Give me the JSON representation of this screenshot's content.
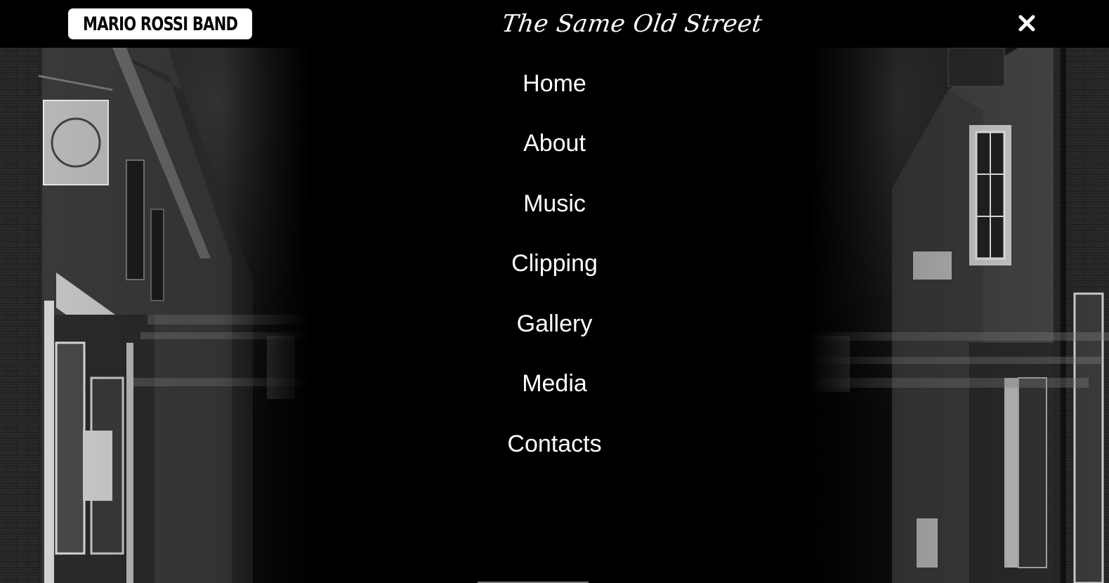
{
  "header": {
    "logo_text": "Mario Rossi Band",
    "site_title": "The Same Old Street",
    "close_icon": "close-icon"
  },
  "menu": {
    "items": [
      {
        "label": "Home"
      },
      {
        "label": "About"
      },
      {
        "label": "Music"
      },
      {
        "label": "Clipping"
      },
      {
        "label": "Gallery"
      },
      {
        "label": "Media"
      },
      {
        "label": "Contacts"
      }
    ]
  },
  "colors": {
    "background": "#000000",
    "text": "#ffffff"
  }
}
